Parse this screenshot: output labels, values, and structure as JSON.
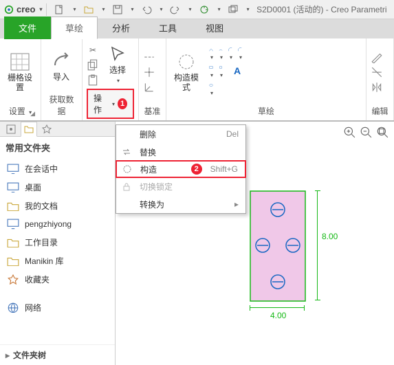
{
  "app": {
    "brand": "creo",
    "doctitle": "S2D0001 (活动的) - Creo Parametri"
  },
  "tabs": {
    "file": "文件",
    "sketch": "草绘",
    "analysis": "分析",
    "tools": "工具",
    "view": "视图"
  },
  "ribbon": {
    "grid_settings": "栅格设置",
    "import": "导入",
    "select": "选择",
    "construction_mode": "构造模式",
    "group_settings": "设置",
    "group_get_data": "获取数据",
    "group_operations": "操作",
    "group_datum": "基准",
    "group_sketch": "草绘",
    "group_edit": "编辑",
    "u": {
      "d": "▾"
    }
  },
  "callouts": {
    "num1": "1",
    "num2": "2"
  },
  "menu": {
    "delete": "删除",
    "delete_key": "Del",
    "replace": "替换",
    "construct": "构造",
    "construct_key": "Shift+G",
    "toggle_lock": "切换锁定",
    "convert": "转换为",
    "sub": "▸"
  },
  "sidebar": {
    "header": "常用文件夹",
    "items": [
      {
        "icon": "monitor",
        "label": "在会话中"
      },
      {
        "icon": "monitor",
        "label": "桌面"
      },
      {
        "icon": "folder",
        "label": "我的文档"
      },
      {
        "icon": "monitor",
        "label": "pengzhiyong"
      },
      {
        "icon": "folder",
        "label": "工作目录"
      },
      {
        "icon": "folder",
        "label": "Manikin 库"
      },
      {
        "icon": "star",
        "label": "收藏夹"
      }
    ],
    "network": "网络",
    "tree_header": "文件夹树"
  },
  "chart_data": {
    "type": "table",
    "description": "2D sketch of a rectangle with 4 circular features (constraint marks) and two dimensions",
    "rect": {
      "width": 4.0,
      "height": 8.0,
      "color": "#14b814",
      "fill": "#f0c8e8"
    },
    "circles": [
      {
        "x": 2.0,
        "y": 1.4,
        "r": 0.6
      },
      {
        "x": 0.9,
        "y": 4.0,
        "r": 0.6
      },
      {
        "x": 3.1,
        "y": 4.0,
        "r": 0.6
      },
      {
        "x": 2.0,
        "y": 6.6,
        "r": 0.6
      }
    ],
    "dims": {
      "width_label": "4.00",
      "height_label": "8.00"
    }
  }
}
